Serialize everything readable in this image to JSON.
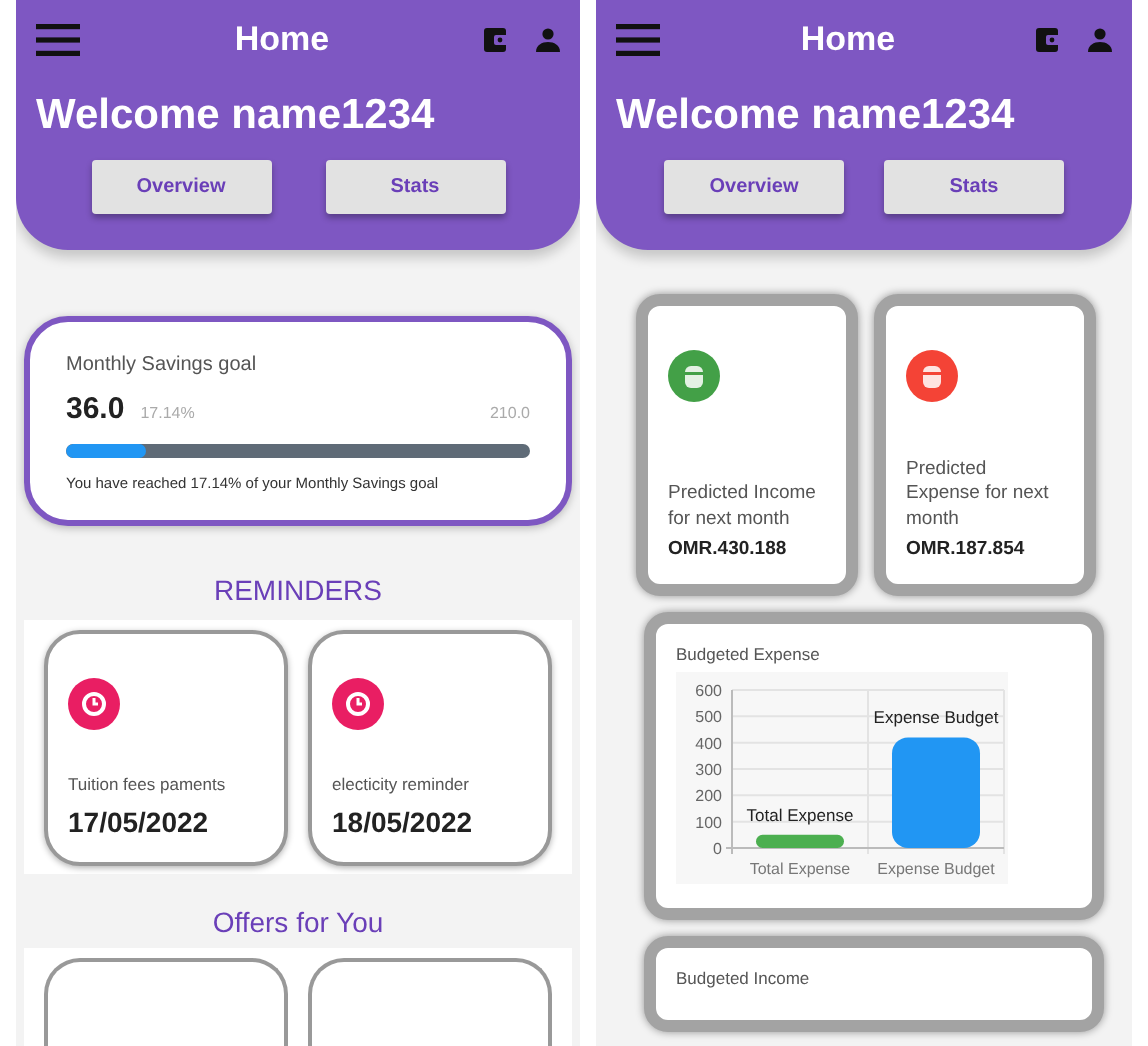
{
  "screens": [
    {
      "header": {
        "title": "Home",
        "welcome": "Welcome name1234",
        "buttons": [
          {
            "label": "Overview"
          },
          {
            "label": "Stats"
          }
        ]
      },
      "sections": [
        {
          "kind": "savings",
          "title": "Monthly Savings goal",
          "amount": "36.0",
          "percent": "17.14%",
          "target": "210.0",
          "level": 0.1714,
          "message": "You have reached 17.14% of your Monthly Savings goal"
        },
        {
          "kind": "reminders",
          "title": "REMINDERS",
          "items": [
            {
              "label": "Tuition fees paments",
              "date": "17/05/2022"
            },
            {
              "label": "electicity reminder",
              "date": "18/05/2022"
            }
          ]
        },
        {
          "kind": "offers",
          "title": "Offers for You"
        }
      ]
    },
    {
      "header": {
        "title": "Home",
        "welcome": "Welcome name1234",
        "buttons": [
          {
            "label": "Overview"
          },
          {
            "label": "Stats"
          }
        ]
      },
      "sections": [
        {
          "kind": "predictions",
          "items": [
            {
              "label": "Predicted Income for next month",
              "amount": "OMR.430.188",
              "color": "#43a047"
            },
            {
              "label": "Predicted Expense for next month",
              "amount": "OMR.187.854",
              "color": "#f44336"
            }
          ]
        },
        {
          "kind": "chart",
          "title": "Budgeted Expense",
          "chart_data": {
            "type": "bar",
            "categories": [
              "Total Expense",
              "Expense Budget"
            ],
            "series": [
              {
                "name": "Total Expense",
                "color": "#4caf50",
                "values": [
                  50,
                  null
                ]
              },
              {
                "name": "Expense Budget",
                "color": "#2196f3",
                "values": [
                  null,
                  420
                ]
              }
            ],
            "ylim": [
              0,
              600
            ],
            "yticks": [
              0,
              100,
              200,
              300,
              400,
              500,
              600
            ],
            "grid": true
          }
        },
        {
          "kind": "chart_stub",
          "title": "Budgeted Income"
        }
      ]
    }
  ]
}
